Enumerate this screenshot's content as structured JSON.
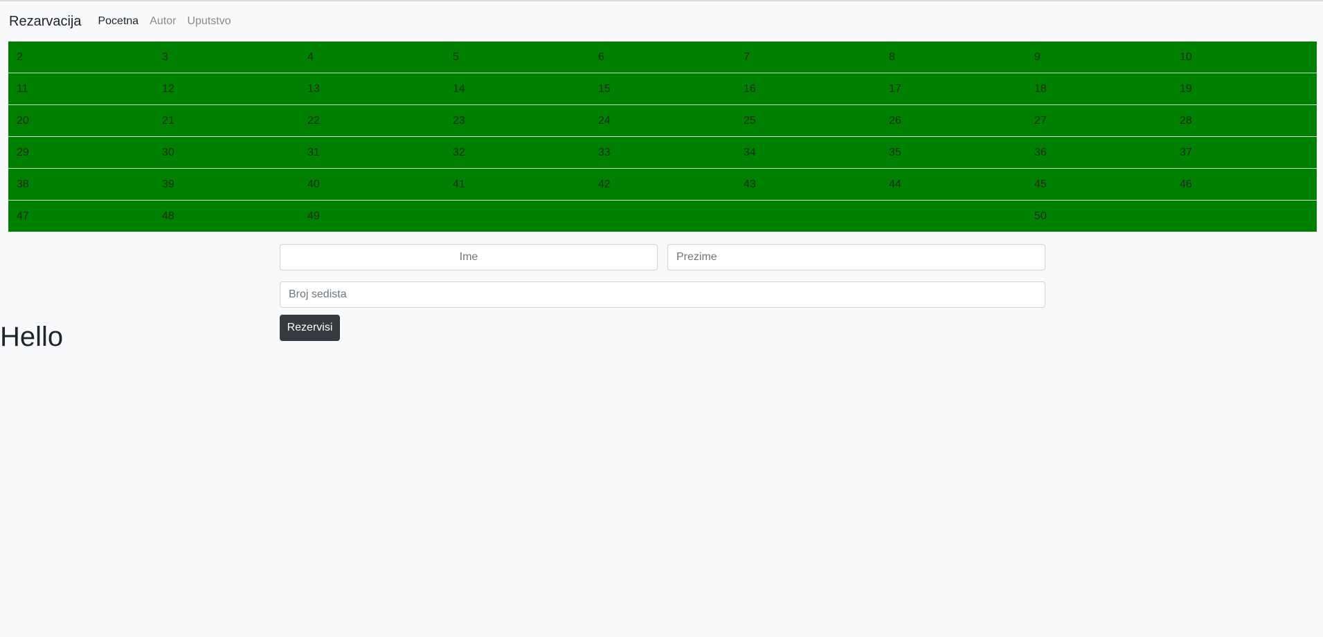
{
  "navbar": {
    "brand": "Rezarvacija",
    "links": [
      {
        "label": "Pocetna",
        "active": true
      },
      {
        "label": "Autor",
        "active": false
      },
      {
        "label": "Uputstvo",
        "active": false
      }
    ]
  },
  "seats": {
    "rows": [
      [
        "2",
        "3",
        "4",
        "5",
        "6",
        "7",
        "8",
        "9",
        "10"
      ],
      [
        "11",
        "12",
        "13",
        "14",
        "15",
        "16",
        "17",
        "18",
        "19"
      ],
      [
        "20",
        "21",
        "22",
        "23",
        "24",
        "25",
        "26",
        "27",
        "28"
      ],
      [
        "29",
        "30",
        "31",
        "32",
        "33",
        "34",
        "35",
        "36",
        "37"
      ],
      [
        "38",
        "39",
        "40",
        "41",
        "42",
        "43",
        "44",
        "45",
        "46"
      ],
      [
        "47",
        "48",
        "49",
        "",
        "",
        "",
        "",
        "50",
        ""
      ]
    ],
    "available_color": "#008000"
  },
  "form": {
    "first_name_placeholder": "Ime",
    "last_name_placeholder": "Prezime",
    "seat_number_placeholder": "Broj sedista",
    "submit_label": "Rezervisi"
  },
  "heading": "Hello"
}
